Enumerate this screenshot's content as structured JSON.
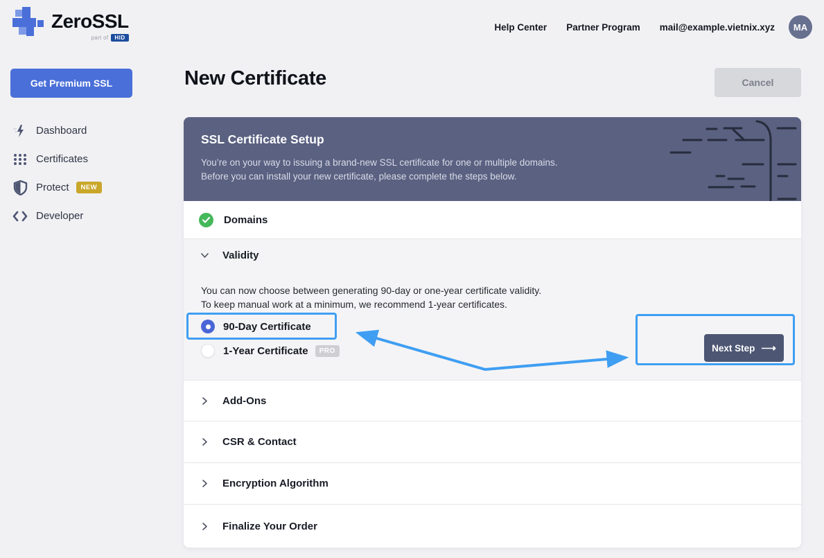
{
  "topbar": {
    "logo": {
      "brand": "ZeroSSL",
      "tagline": "part of",
      "tagline_badge": "HID"
    },
    "links": [
      {
        "label": "Help Center"
      },
      {
        "label": "Partner Program"
      }
    ],
    "email": "mail@example.vietnix.xyz",
    "avatar_initials": "MA"
  },
  "sidebar": {
    "cta_label": "Get Premium SSL",
    "items": [
      {
        "label": "Dashboard",
        "icon": "dashboard-bolt-icon"
      },
      {
        "label": "Certificates",
        "icon": "certificates-grid-icon"
      },
      {
        "label": "Protect",
        "icon": "shield-icon",
        "badge": "NEW"
      },
      {
        "label": "Developer",
        "icon": "code-brackets-icon"
      }
    ]
  },
  "page": {
    "title": "New Certificate",
    "cancel_label": "Cancel"
  },
  "card": {
    "header": {
      "title": "SSL Certificate Setup",
      "description_line1": "You’re on your way to issuing a brand-new SSL certificate for one or multiple domains.",
      "description_line2": "Before you can install your new certificate, please complete the steps below."
    },
    "steps": {
      "domains": {
        "label": "Domains",
        "status": "complete"
      },
      "validity": {
        "label": "Validity",
        "description_line1": "You can now choose between generating 90-day or one-year certificate validity.",
        "description_line2": "To keep manual work at a minimum, we recommend 1-year certificates.",
        "options": [
          {
            "label": "90-Day Certificate",
            "selected": true
          },
          {
            "label": "1-Year Certificate",
            "selected": false,
            "badge": "PRO"
          }
        ],
        "next_button_label": "Next Step"
      },
      "collapsed": [
        {
          "label": "Add-Ons"
        },
        {
          "label": "CSR & Contact"
        },
        {
          "label": "Encryption Algorithm"
        },
        {
          "label": "Finalize Your Order"
        }
      ]
    }
  },
  "colors": {
    "accent_blue": "#4a6fd9",
    "header_slate": "#5a6181",
    "annotation_blue": "#3f9ef2",
    "success_green": "#45b85a",
    "new_badge_gold": "#c9a72a"
  }
}
